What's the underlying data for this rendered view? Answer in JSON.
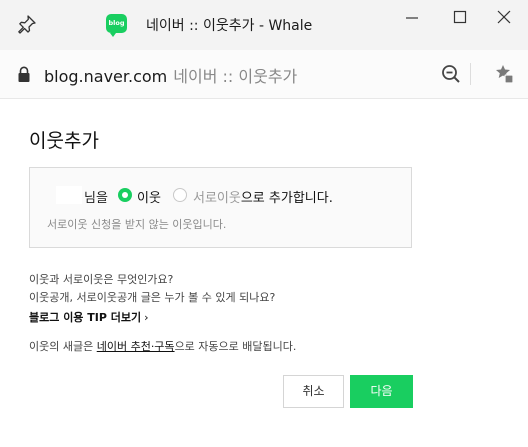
{
  "window": {
    "favicon_text": "blog",
    "title": "네이버 :: 이웃추가 - Whale"
  },
  "address": {
    "host": "blog.naver.com",
    "page_title": "네이버 :: 이웃추가"
  },
  "dialog": {
    "heading": "이웃추가",
    "nickname_suffix": "님을",
    "option_neighbor": "이웃",
    "option_mutual": "서로이웃",
    "option_mutual_suffix": "으로 추가합니다.",
    "selected_option": "이웃",
    "description": "서로이웃 신청을 받지 않는 이웃입니다.",
    "faq1": "이웃과 서로이웃은 무엇인가요?",
    "faq2": "이웃공개, 서로이웃공개 글은 누가 볼 수 있게 되나요?",
    "tip_link": "블로그 이용 TIP 더보기",
    "tip_chevron": "›",
    "note_prefix": "이웃의 새글은 ",
    "note_link": "네이버 추천·구독",
    "note_suffix": "으로 자동으로 배달됩니다.",
    "cancel": "취소",
    "next": "다음"
  },
  "colors": {
    "accent": "#19ce60",
    "titlebar": "#f3f3f3"
  }
}
